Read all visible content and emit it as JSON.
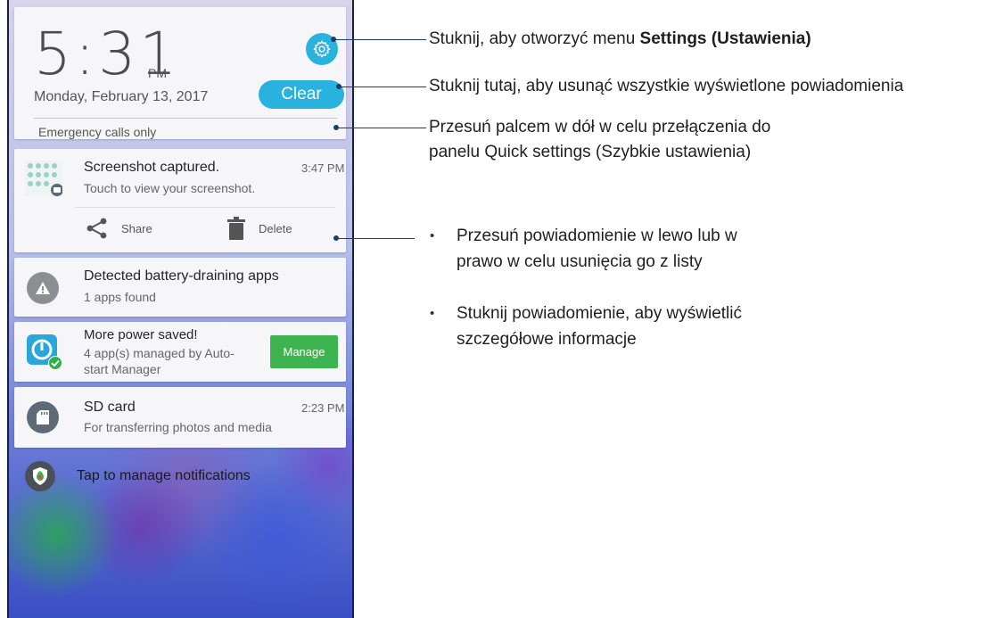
{
  "status": {
    "time": "5:31",
    "ampm": "PM",
    "date": "Monday, February 13, 2017",
    "clear_label": "Clear",
    "emergency": "Emergency calls only"
  },
  "notifications": [
    {
      "title": "Screenshot captured.",
      "subtitle": "Touch to view your screenshot.",
      "time": "3:47 PM",
      "actions": {
        "share": "Share",
        "delete": "Delete"
      }
    },
    {
      "title": "Detected battery-draining apps",
      "subtitle": "1 apps found"
    },
    {
      "title": "More power saved!",
      "subtitle_line1": "4 app(s) managed by Auto-",
      "subtitle_line2": "start Manager",
      "button": "Manage"
    },
    {
      "title": "SD card",
      "subtitle": "For transferring photos and media",
      "time": "2:23 PM"
    }
  ],
  "manage_notifications": "Tap to manage notifications",
  "callouts": {
    "settings_prefix": "Stuknij, aby otworzyć menu ",
    "settings_bold": "Settings (Ustawienia)",
    "clear": "Stuknij tutaj, aby usunąć wszystkie wyświetlone powiadomienia",
    "swipe_line1": "Przesuń palcem w dół w celu przełączenia do",
    "swipe_line2": "panelu Quick settings (Szybkie ustawienia)",
    "bullet1_line1": "Przesuń powiadomienie w lewo lub w",
    "bullet1_line2": "prawo w celu usunięcia go z listy",
    "bullet2_line1": "Stuknij powiadomienie, aby wyświetlić",
    "bullet2_line2": "szczegółowe informacje"
  },
  "colors": {
    "accent": "#2ab2df",
    "manage": "#3db44f",
    "callout_line": "#1a3d6e"
  },
  "icons": [
    "gear-icon",
    "share-icon",
    "trash-icon",
    "warning-icon",
    "power-gauge-icon",
    "check-badge-icon",
    "sd-card-icon",
    "shield-icon"
  ]
}
